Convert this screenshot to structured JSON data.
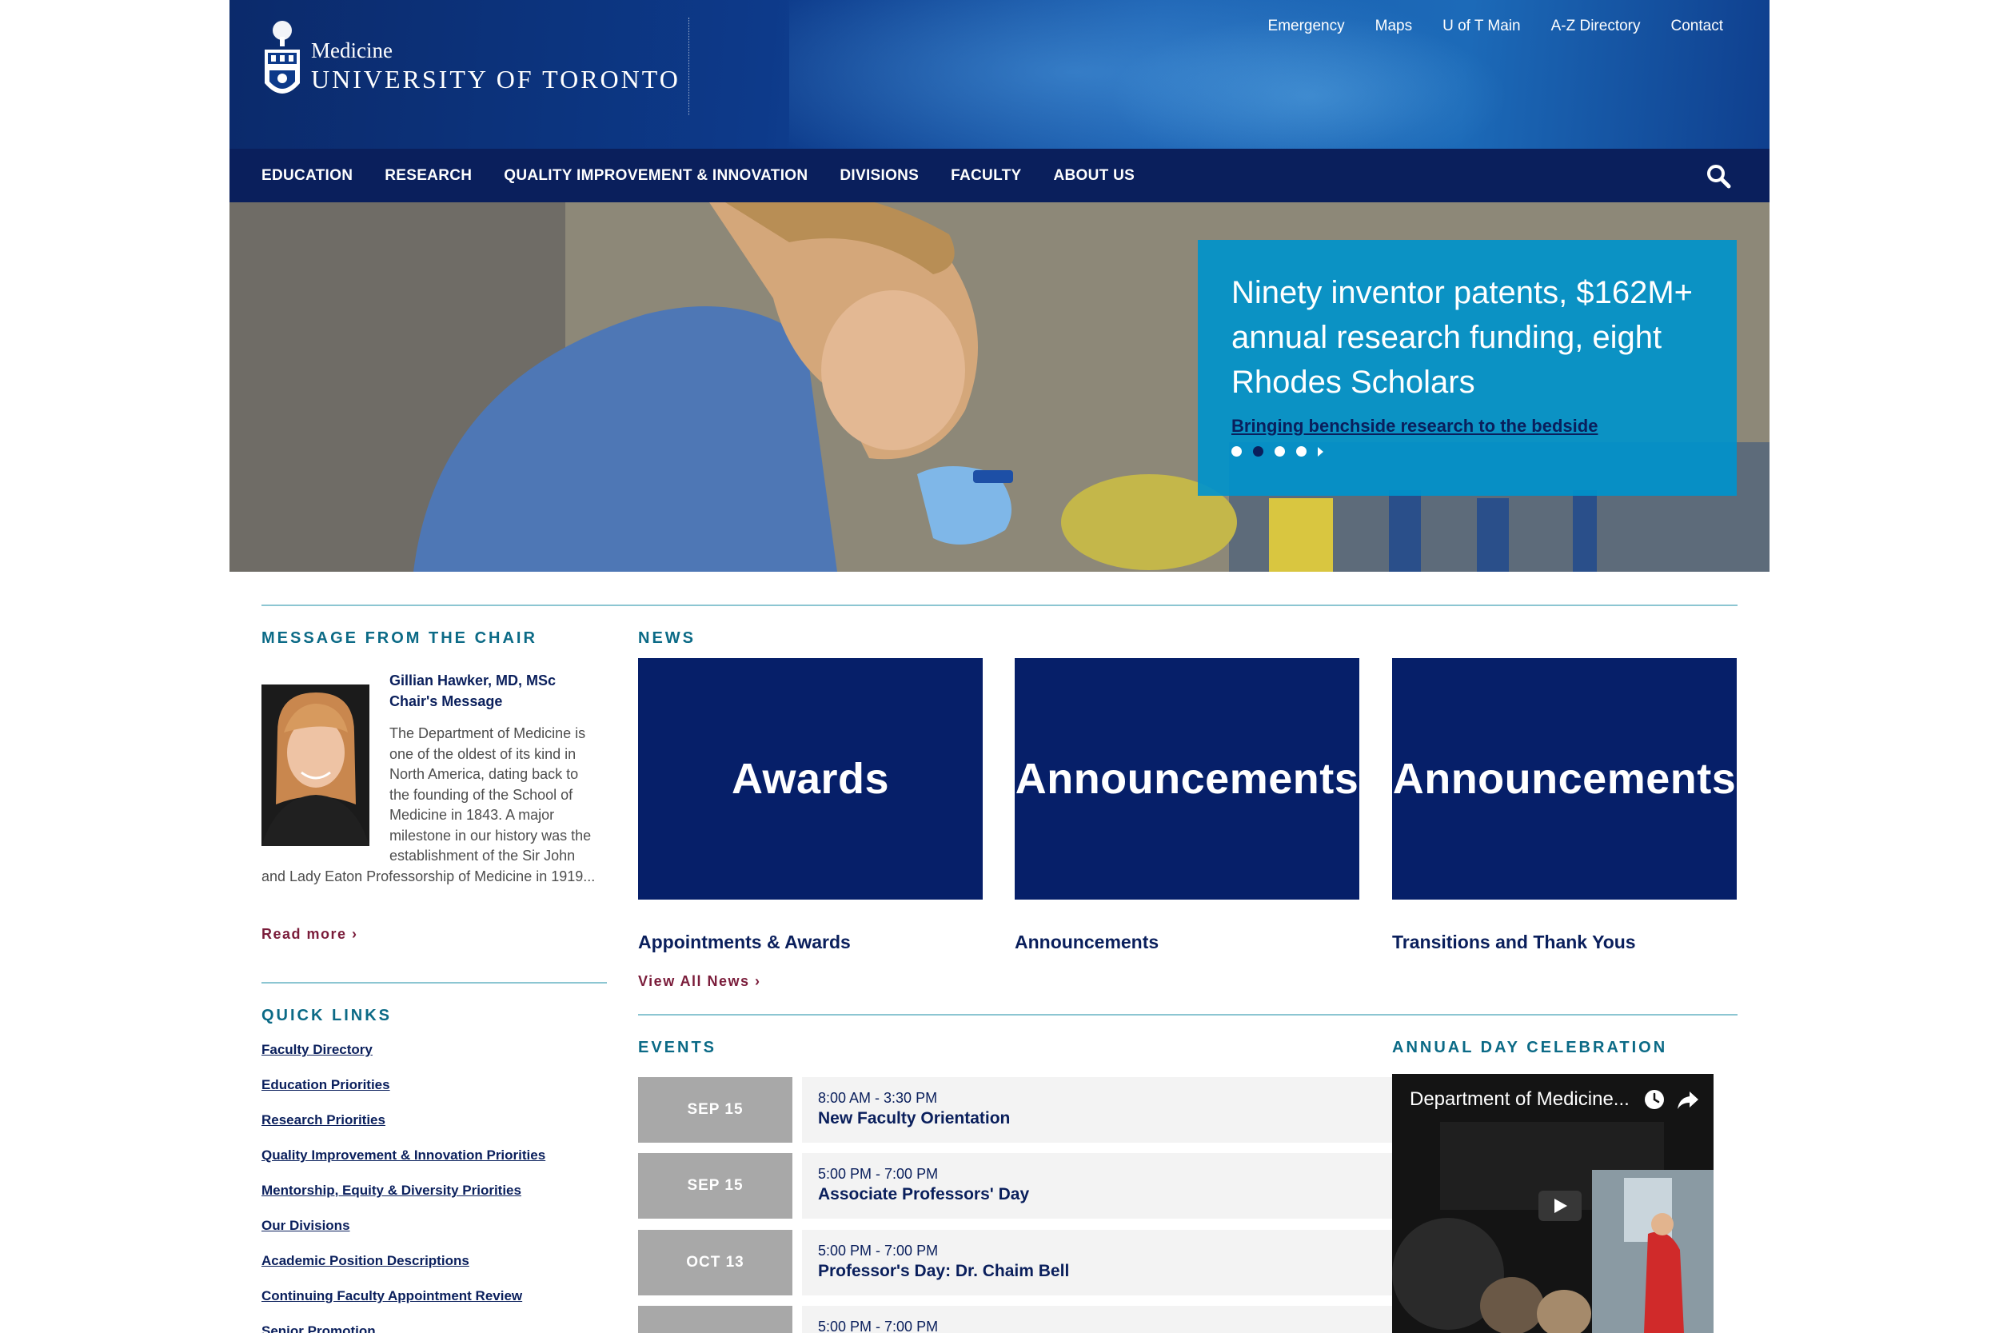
{
  "header": {
    "logo_sub": "Medicine",
    "logo_main": "UNIVERSITY OF TORONTO",
    "utility_links": [
      "Emergency",
      "Maps",
      "U of T Main",
      "A-Z Directory",
      "Contact"
    ]
  },
  "nav": {
    "items": [
      "EDUCATION",
      "RESEARCH",
      "QUALITY IMPROVEMENT & INNOVATION",
      "DIVISIONS",
      "FACULTY",
      "ABOUT US"
    ]
  },
  "hero": {
    "title": "Ninety inventor patents, $162M+ annual research funding, eight Rhodes Scholars",
    "link": "Bringing benchside research to the bedside",
    "slide_count": 4,
    "active_slide": 2
  },
  "chair": {
    "section_title": "MESSAGE FROM THE CHAIR",
    "name": "Gillian Hawker, MD, MSc",
    "subtitle": "Chair's Message",
    "body_indented": [
      "The Department of Medicine is",
      "one of the oldest of its kind in",
      "North America, dating back to",
      "the founding of the School of",
      "Medicine in 1843. A major",
      "milestone in our history was the",
      "establishment of the Sir John"
    ],
    "body_full": "and Lady Eaton Professorship of Medicine in 1919...",
    "read_more": "Read more ›"
  },
  "quick_links": {
    "section_title": "QUICK LINKS",
    "items": [
      "Faculty Directory",
      "Education Priorities",
      "Research Priorities",
      "Quality Improvement & Innovation Priorities",
      "Mentorship, Equity & Diversity Priorities",
      "Our Divisions",
      "Academic Position Descriptions",
      "Continuing Faculty Appointment Review",
      "Senior Promotion"
    ]
  },
  "news": {
    "section_title": "NEWS",
    "tiles": [
      {
        "tile_text": "Awards",
        "label": "Appointments & Awards"
      },
      {
        "tile_text": "Announcements",
        "label": "Announcements"
      },
      {
        "tile_text": "Announcements",
        "label": "Transitions and Thank Yous"
      }
    ],
    "view_all": "View All News ›"
  },
  "events": {
    "section_title": "EVENTS",
    "items": [
      {
        "date": "SEP 15",
        "time": "8:00 AM - 3:30 PM",
        "name": "New Faculty Orientation"
      },
      {
        "date": "SEP 15",
        "time": "5:00 PM - 7:00 PM",
        "name": "Associate Professors' Day"
      },
      {
        "date": "OCT 13",
        "time": "5:00 PM - 7:00 PM",
        "name": "Professor's Day: Dr. Chaim Bell"
      },
      {
        "date": "",
        "time": "5:00 PM - 7:00 PM",
        "name": ""
      }
    ]
  },
  "annual_day": {
    "section_title": "ANNUAL DAY CELEBRATION",
    "video_title": "Department of Medicine..."
  },
  "colors": {
    "header_blue": "#0d3a8a",
    "nav_navy": "#0a1f5c",
    "hero_card": "#0092cb",
    "news_tile": "#061f69",
    "section_teal": "#0b6a86",
    "link_maroon": "#7a1c3a",
    "event_date_gray": "#a8a8a8"
  },
  "icons": {
    "search": "search-icon",
    "crest": "uoft-crest-icon",
    "clock": "watch-later-icon",
    "share": "share-icon",
    "play": "play-icon"
  }
}
